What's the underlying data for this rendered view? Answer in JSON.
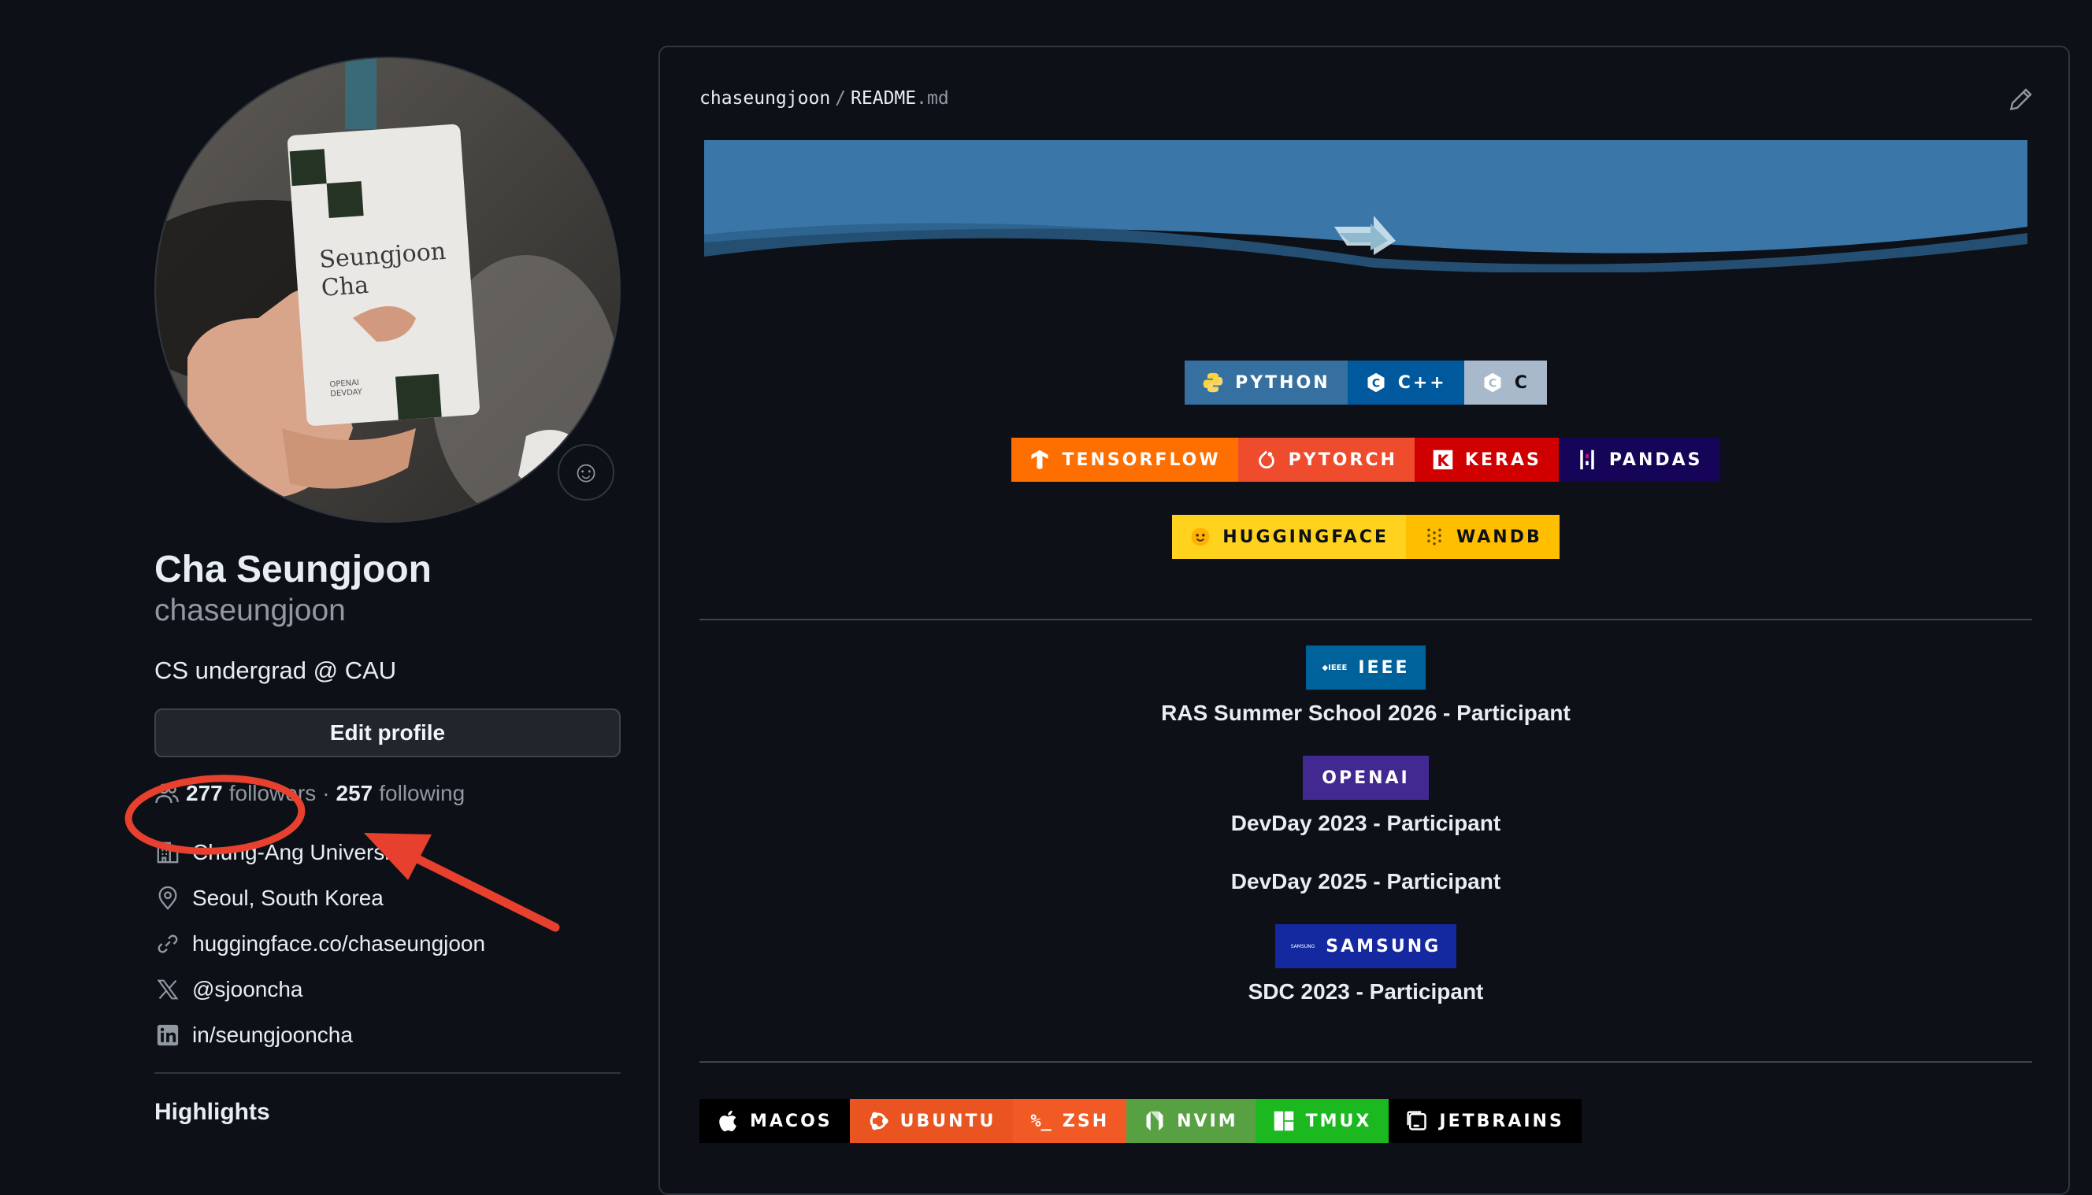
{
  "profile": {
    "name": "Cha Seungjoon",
    "login": "chaseungjoon",
    "bio": "CS undergrad @ CAU",
    "edit_label": "Edit profile",
    "followers_count": "277",
    "followers_label": "followers",
    "dot": "·",
    "following_count": "257",
    "following_label": "following",
    "details": [
      {
        "icon": "organization-icon",
        "text": "Chung-Ang University"
      },
      {
        "icon": "location-icon",
        "text": "Seoul, South Korea"
      },
      {
        "icon": "link-icon",
        "text": "huggingface.co/chaseungjoon"
      },
      {
        "icon": "x-logo-icon",
        "text": "@sjooncha"
      },
      {
        "icon": "linkedin-icon",
        "text": "in/seungjooncha"
      }
    ],
    "highlights_label": "Highlights",
    "avatar_badge": {
      "line1": "Seungjoon",
      "line2": "Cha",
      "small1": "OPENAI",
      "small2": "DEVDAY"
    }
  },
  "readme": {
    "owner": "chaseungjoon",
    "sep": "/",
    "file_base": "README",
    "file_ext": ".md",
    "languages": [
      {
        "label": "PYTHON",
        "color": "#3670a0",
        "icon": "python-icon"
      },
      {
        "label": "C++",
        "color": "#00599c",
        "icon": "cpp-icon"
      },
      {
        "label": "C",
        "color": "#a8b9cc",
        "icon": "c-icon"
      }
    ],
    "ml": [
      {
        "label": "TENSORFLOW",
        "color": "#ff6f00",
        "icon": "tensorflow-icon"
      },
      {
        "label": "PYTORCH",
        "color": "#ee4c2c",
        "icon": "pytorch-icon"
      },
      {
        "label": "KERAS",
        "color": "#d00000",
        "icon": "keras-icon"
      },
      {
        "label": "PANDAS",
        "color": "#150458",
        "icon": "pandas-icon"
      }
    ],
    "tools": [
      {
        "label": "HUGGINGFACE",
        "color": "#ffd21e",
        "icon": "huggingface-icon"
      },
      {
        "label": "WANDB",
        "color": "#ffbe00",
        "icon": "wandb-icon"
      }
    ],
    "events": [
      {
        "badge": "IEEE",
        "badge_color": "#00629b",
        "icon": "ieee-icon",
        "icon_text": "◆IEEE",
        "lines": [
          "RAS Summer School 2026 - Participant"
        ]
      },
      {
        "badge": "OPENAI",
        "badge_color": "#412991",
        "icon": "",
        "icon_text": "",
        "lines": [
          "DevDay 2023 - Participant",
          "DevDay 2025 - Participant"
        ]
      },
      {
        "badge": "SAMSUNG",
        "badge_color": "#1428a0",
        "icon": "samsung-icon",
        "icon_text": "SAMSUNG",
        "lines": [
          "SDC 2023 - Participant"
        ]
      }
    ],
    "env": [
      {
        "label": "MACOS",
        "color": "#000000",
        "icon": "apple-icon"
      },
      {
        "label": "UBUNTU",
        "color": "#e95420",
        "icon": "ubuntu-icon"
      },
      {
        "label": "ZSH",
        "color": "#f15a24",
        "icon": "zsh-icon",
        "icon_text": "%_"
      },
      {
        "label": "NVIM",
        "color": "#57a143",
        "icon": "neovim-icon"
      },
      {
        "label": "TMUX",
        "color": "#1bb91f",
        "icon": "tmux-icon"
      },
      {
        "label": "JETBRAINS",
        "color": "#000000",
        "icon": "jetbrains-icon"
      }
    ]
  },
  "colors": {
    "background": "#0d1117",
    "border": "#30363d",
    "text": "#e6edf3",
    "muted": "#9198a1",
    "annotation": "#e8402e"
  }
}
